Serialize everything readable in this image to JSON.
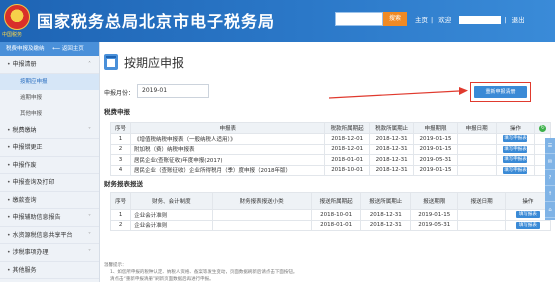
{
  "header": {
    "site_title": "国家税务总局北京市电子税务局",
    "emblem_text": "中国税务",
    "search_button": "搜索",
    "links": [
      "主页",
      "欢迎",
      "退出"
    ]
  },
  "sidebar": {
    "top": [
      "税费申报及缴纳",
      "返回主页"
    ],
    "items": [
      {
        "label": "申报清册",
        "expanded": true,
        "children": [
          "按期应申报",
          "逾期申报",
          "其他申报"
        ]
      },
      {
        "label": "税费缴纳"
      },
      {
        "label": "申报错更正"
      },
      {
        "label": "申报作废"
      },
      {
        "label": "申报查询及打印"
      },
      {
        "label": "缴款查询"
      },
      {
        "label": "申报辅助信息报告"
      },
      {
        "label": "水资源税信息共享平台"
      },
      {
        "label": "涉税事项办理"
      },
      {
        "label": "其他服务"
      }
    ],
    "active_child": "按期应申报"
  },
  "main": {
    "title": "按期应申报",
    "period_label": "申报月份：",
    "period_value": "2019-01",
    "redo_button": "重新申报清册",
    "tax_section_title": "税费申报",
    "tax_table": {
      "headers": [
        "序号",
        "申报表",
        "税款所属期起",
        "税款所属期止",
        "申报期限",
        "申报日期",
        "操作"
      ],
      "rows": [
        [
          "1",
          "《增值税纳税申报表（一般纳税人适用）》",
          "2018-12-01",
          "2018-12-31",
          "2019-01-15",
          "",
          "填写申报表"
        ],
        [
          "2",
          "附加税（费）纳税申报表",
          "2018-12-01",
          "2018-12-31",
          "2019-01-15",
          "",
          "填写申报表"
        ],
        [
          "3",
          "居民企业(查账征收)年度申报(2017)",
          "2018-01-01",
          "2018-12-31",
          "2019-05-31",
          "",
          "填写申报表"
        ],
        [
          "4",
          "居民企业（查账征收）企业所得税月（季）度申报（2018年版）",
          "2018-10-01",
          "2018-12-31",
          "2019-01-15",
          "",
          "填写申报表"
        ]
      ]
    },
    "finance_section_title": "财务报表报送",
    "finance_table": {
      "headers": [
        "序号",
        "财务、会计制度",
        "财务报表报送小类",
        "报送所属期起",
        "报送所属期止",
        "报送期限",
        "报送日期",
        "操作"
      ],
      "rows": [
        [
          "1",
          "企业会计准则",
          "",
          "2018-10-01",
          "2018-12-31",
          "2019-01-15",
          "",
          "填写报表"
        ],
        [
          "2",
          "企业会计准则",
          "",
          "2018-01-01",
          "2018-12-31",
          "2019-05-31",
          "",
          "填写报表"
        ]
      ]
    },
    "notes": [
      "温馨提示：",
      "1、如您所申报的税种认定、纳税人资格、备案等发生变动，页面数据刷新后请点击下面按钮。",
      "清点击“重新申报清册”刷新页面数据后再进行申报。"
    ],
    "notes_highlight": "重新申报清册"
  },
  "colors": {
    "header": "#2b78c8",
    "accent": "#3a8ad6",
    "annotation": "#e03a2e"
  }
}
